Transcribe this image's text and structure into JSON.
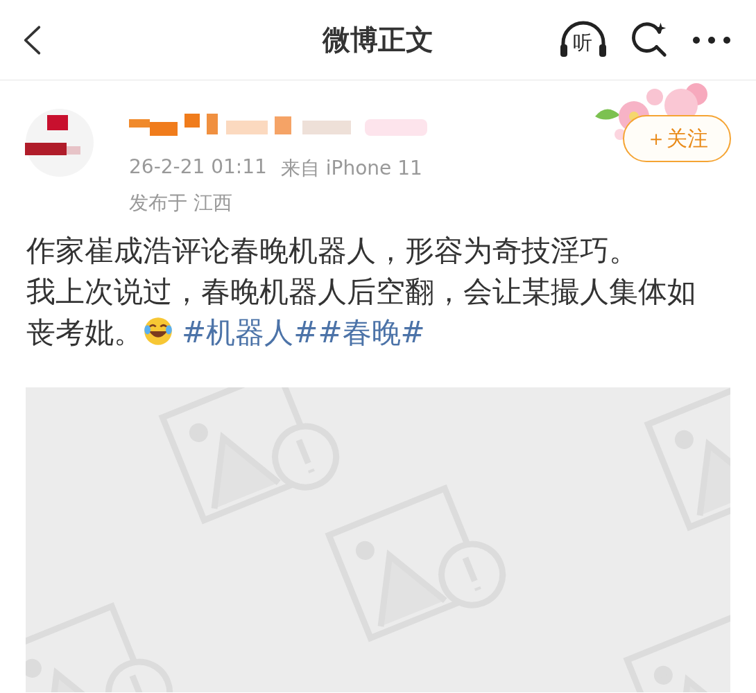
{
  "header": {
    "title": "微博正文",
    "listen_label": "听"
  },
  "post": {
    "time": "26-2-21 01:11",
    "source": "来自 iPhone 11",
    "location": "发布于 江西",
    "follow_label": "＋关注",
    "paragraphs": [
      "作家崔成浩评论春晚机器人，形容为奇技淫巧。",
      "我上次说过，春晚机器人后空翻，会让某撮人集体如丧考妣。"
    ],
    "topics": [
      "#机器人#",
      "#春晚#"
    ]
  }
}
